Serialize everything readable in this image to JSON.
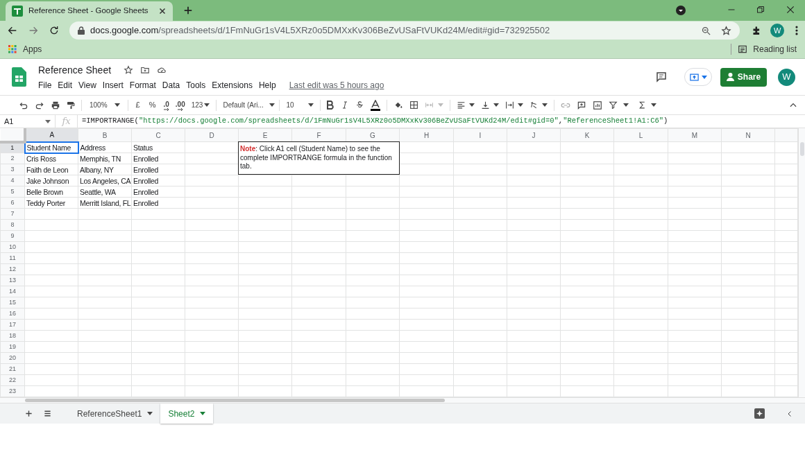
{
  "browser": {
    "tab_title": "Reference Sheet - Google Sheets",
    "url_domain": "docs.google.com",
    "url_path": "/spreadsheets/d/1FmNuGr1sV4L5XRz0o5DMXxKv306BeZvUSaFtVUKd24M/edit#gid=732925502",
    "profile": "W",
    "bookmarks": [
      "Apps"
    ],
    "reading_list": "Reading list"
  },
  "doc": {
    "title": "Reference Sheet",
    "menus": [
      "File",
      "Edit",
      "View",
      "Insert",
      "Format",
      "Data",
      "Tools",
      "Extensions",
      "Help"
    ],
    "last_edit": "Last edit was 5 hours ago",
    "share": "Share",
    "avatar": "W"
  },
  "toolbar": [
    {
      "kind": "zoom",
      "text": "100%"
    },
    {
      "kind": "text",
      "text": "£"
    },
    {
      "kind": "text",
      "text": "%"
    },
    {
      "kind": "decimal",
      "text": ".0"
    },
    {
      "kind": "decimal",
      "text": ".00"
    },
    {
      "kind": "dropdown",
      "text": "123"
    },
    {
      "kind": "font",
      "text": "Default (Ari..."
    },
    {
      "kind": "size",
      "text": "10"
    }
  ],
  "formula_bar": {
    "name_box": "A1",
    "function_label": "fx",
    "segments": [
      {
        "kind": "plain",
        "text": "=IMPORTRANGE("
      },
      {
        "kind": "string",
        "text": "\"https://docs.google.com/spreadsheets/d/1FmNuGr1sV4L5XRz0o5DMXxKv306BeZvUSaFtVUKd24M/edit#gid=0\""
      },
      {
        "kind": "plain",
        "text": ","
      },
      {
        "kind": "string",
        "text": "\"ReferenceSheet1!A1:C6\""
      },
      {
        "kind": "plain",
        "text": ")"
      }
    ]
  },
  "grid": {
    "columns": [
      {
        "label": "A",
        "selected": true
      },
      {
        "label": "B",
        "selected": false
      },
      {
        "label": "C",
        "selected": false
      },
      {
        "label": "D",
        "selected": false
      },
      {
        "label": "E",
        "selected": false
      },
      {
        "label": "F",
        "selected": false
      },
      {
        "label": "G",
        "selected": false
      },
      {
        "label": "H",
        "selected": false
      },
      {
        "label": "I",
        "selected": false
      },
      {
        "label": "J",
        "selected": false
      },
      {
        "label": "K",
        "selected": false
      },
      {
        "label": "L",
        "selected": false
      },
      {
        "label": "M",
        "selected": false
      },
      {
        "label": "N",
        "selected": false
      }
    ],
    "rows": [
      {
        "label": "1",
        "selected": true,
        "cells": [
          "Student Name",
          "Address",
          "Status"
        ]
      },
      {
        "label": "2",
        "selected": false,
        "cells": [
          "Cris Ross",
          "Memphis, TN",
          "Enrolled"
        ]
      },
      {
        "label": "3",
        "selected": false,
        "cells": [
          "Faith de Leon",
          "Albany, NY",
          "Enrolled"
        ]
      },
      {
        "label": "4",
        "selected": false,
        "cells": [
          "Jake Johnson",
          "Los Angeles, CA",
          "Enrolled"
        ]
      },
      {
        "label": "5",
        "selected": false,
        "cells": [
          "Belle Brown",
          "Seattle, WA",
          "Enrolled"
        ]
      },
      {
        "label": "6",
        "selected": false,
        "cells": [
          "Teddy Porter",
          "Merritt Island, FL",
          "Enrolled"
        ]
      },
      {
        "label": "7",
        "selected": false,
        "cells": []
      },
      {
        "label": "8",
        "selected": false,
        "cells": []
      },
      {
        "label": "9",
        "selected": false,
        "cells": []
      },
      {
        "label": "10",
        "selected": false,
        "cells": []
      },
      {
        "label": "11",
        "selected": false,
        "cells": []
      },
      {
        "label": "12",
        "selected": false,
        "cells": []
      },
      {
        "label": "13",
        "selected": false,
        "cells": []
      },
      {
        "label": "14",
        "selected": false,
        "cells": []
      },
      {
        "label": "15",
        "selected": false,
        "cells": []
      },
      {
        "label": "16",
        "selected": false,
        "cells": []
      },
      {
        "label": "17",
        "selected": false,
        "cells": []
      },
      {
        "label": "18",
        "selected": false,
        "cells": []
      },
      {
        "label": "19",
        "selected": false,
        "cells": []
      },
      {
        "label": "20",
        "selected": false,
        "cells": []
      },
      {
        "label": "21",
        "selected": false,
        "cells": []
      },
      {
        "label": "22",
        "selected": false,
        "cells": []
      },
      {
        "label": "23",
        "selected": false,
        "cells": []
      }
    ],
    "note": {
      "label": "Note",
      "text": ": Click A1 cell (Student Name) to see the complete IMPORTRANGE formula in the function tab."
    }
  },
  "sheet_tabs": [
    {
      "label": "ReferenceSheet1",
      "selected": false
    },
    {
      "label": "Sheet2",
      "selected": true
    }
  ]
}
